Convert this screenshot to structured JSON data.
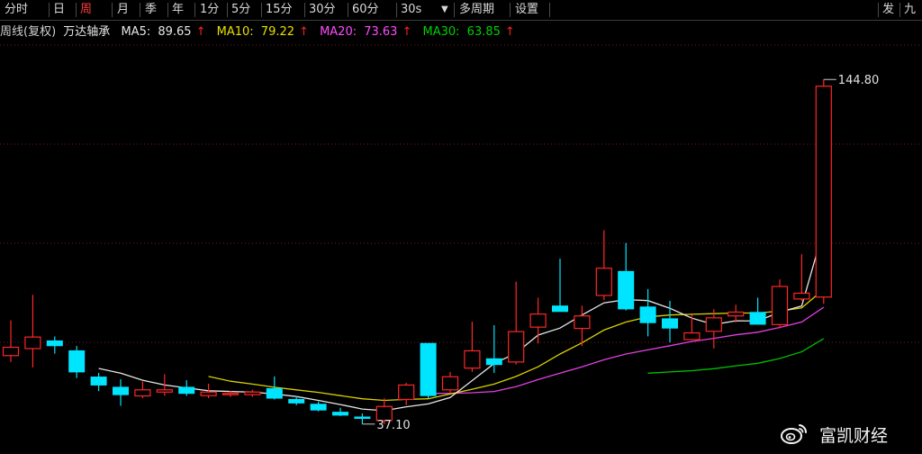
{
  "toolbar": {
    "items": [
      {
        "label": "分时",
        "active": false
      },
      {
        "label": "日",
        "active": false
      },
      {
        "label": "周",
        "active": true
      },
      {
        "label": "月",
        "active": false
      },
      {
        "label": "季",
        "active": false
      },
      {
        "label": "年",
        "active": false
      },
      {
        "label": "1分",
        "active": false
      },
      {
        "label": "5分",
        "active": false
      },
      {
        "label": "15分",
        "active": false
      },
      {
        "label": "30分",
        "active": false
      },
      {
        "label": "60分",
        "active": false
      },
      {
        "label": "30s",
        "active": false,
        "dropdown": true
      },
      {
        "label": "多周期",
        "active": false
      },
      {
        "label": "设置",
        "active": false
      }
    ],
    "right_items": [
      "发",
      "九"
    ]
  },
  "info": {
    "period_label": "周线(复权)",
    "stock_name": "万达轴承",
    "ma5": {
      "label": "MA5:",
      "value": "89.65",
      "arrow": "↑"
    },
    "ma10": {
      "label": "MA10:",
      "value": "79.22",
      "arrow": "↑"
    },
    "ma20": {
      "label": "MA20:",
      "value": "73.63",
      "arrow": "↑"
    },
    "ma30": {
      "label": "MA30:",
      "value": "63.85",
      "arrow": "↑"
    }
  },
  "colors": {
    "up": "#ff2626",
    "down": "#00e5ff",
    "ma5": "#e6e6e6",
    "ma10": "#d8d000",
    "ma20": "#e040e0",
    "ma30": "#00c000",
    "grid": "#7a1a1a"
  },
  "chart_data": {
    "type": "candlestick",
    "ylim": [
      30,
      155
    ],
    "high_label": "144.80",
    "low_label": "37.10",
    "candles": [
      {
        "o": 58.5,
        "h": 69.5,
        "l": 56.5,
        "c": 61.1
      },
      {
        "o": 60.7,
        "h": 77.5,
        "l": 54.8,
        "c": 64.3
      },
      {
        "o": 63.1,
        "h": 64.5,
        "l": 59.1,
        "c": 61.6
      },
      {
        "o": 60.0,
        "h": 61.5,
        "l": 51.5,
        "c": 53.4
      },
      {
        "o": 51.8,
        "h": 53.1,
        "l": 47.4,
        "c": 49.3
      },
      {
        "o": 48.6,
        "h": 51.1,
        "l": 42.8,
        "c": 46.3
      },
      {
        "o": 45.9,
        "h": 50.4,
        "l": 45.2,
        "c": 47.8
      },
      {
        "o": 47.1,
        "h": 52.7,
        "l": 45.9,
        "c": 47.8
      },
      {
        "o": 48.6,
        "h": 50.8,
        "l": 45.9,
        "c": 46.7
      },
      {
        "o": 46.0,
        "h": 49.7,
        "l": 45.2,
        "c": 47.1
      },
      {
        "o": 46.3,
        "h": 47.5,
        "l": 45.6,
        "c": 46.7
      },
      {
        "o": 46.3,
        "h": 47.8,
        "l": 45.6,
        "c": 47.1
      },
      {
        "o": 48.2,
        "h": 52.0,
        "l": 44.8,
        "c": 45.2
      },
      {
        "o": 44.8,
        "h": 45.9,
        "l": 43.0,
        "c": 43.7
      },
      {
        "o": 43.3,
        "h": 44.1,
        "l": 41.1,
        "c": 41.5
      },
      {
        "o": 40.8,
        "h": 42.2,
        "l": 39.6,
        "c": 39.9
      },
      {
        "o": 39.3,
        "h": 40.4,
        "l": 37.1,
        "c": 38.9
      },
      {
        "o": 38.2,
        "h": 45.2,
        "l": 37.1,
        "c": 42.6
      },
      {
        "o": 44.8,
        "h": 50.0,
        "l": 43.0,
        "c": 49.3
      },
      {
        "o": 62.3,
        "h": 62.3,
        "l": 45.2,
        "c": 46.0
      },
      {
        "o": 47.8,
        "h": 53.4,
        "l": 46.7,
        "c": 51.9
      },
      {
        "o": 54.6,
        "h": 69.1,
        "l": 53.4,
        "c": 60.0
      },
      {
        "o": 57.5,
        "h": 68.0,
        "l": 53.1,
        "c": 55.7
      },
      {
        "o": 56.5,
        "h": 81.6,
        "l": 55.7,
        "c": 66.0
      },
      {
        "o": 67.4,
        "h": 76.6,
        "l": 62.3,
        "c": 71.5
      },
      {
        "o": 74.0,
        "h": 88.8,
        "l": 72.6,
        "c": 72.3
      },
      {
        "o": 67.0,
        "h": 74.1,
        "l": 61.5,
        "c": 70.9
      },
      {
        "o": 77.3,
        "h": 97.7,
        "l": 75.8,
        "c": 85.8
      },
      {
        "o": 84.8,
        "h": 93.7,
        "l": 72.6,
        "c": 73.1
      },
      {
        "o": 73.7,
        "h": 79.3,
        "l": 64.5,
        "c": 68.8
      },
      {
        "o": 70.0,
        "h": 75.6,
        "l": 62.6,
        "c": 67.1
      },
      {
        "o": 63.5,
        "h": 71.2,
        "l": 63.5,
        "c": 65.6
      },
      {
        "o": 66.1,
        "h": 73.0,
        "l": 60.7,
        "c": 70.3
      },
      {
        "o": 70.9,
        "h": 74.4,
        "l": 68.8,
        "c": 72.1
      },
      {
        "o": 72.0,
        "h": 76.6,
        "l": 68.6,
        "c": 68.3
      },
      {
        "o": 68.2,
        "h": 82.3,
        "l": 67.0,
        "c": 80.1
      },
      {
        "o": 76.2,
        "h": 90.2,
        "l": 75.6,
        "c": 78.0
      },
      {
        "o": 76.8,
        "h": 144.8,
        "l": 74.7,
        "c": 142.7
      }
    ],
    "ma5": [
      {
        "i": 4,
        "v": 54.5
      },
      {
        "i": 5,
        "v": 53.0
      },
      {
        "i": 6,
        "v": 50.8
      },
      {
        "i": 7,
        "v": 49.3
      },
      {
        "i": 8,
        "v": 48.4
      },
      {
        "i": 9,
        "v": 47.5
      },
      {
        "i": 10,
        "v": 47.3
      },
      {
        "i": 11,
        "v": 47.1
      },
      {
        "i": 12,
        "v": 46.5
      },
      {
        "i": 13,
        "v": 45.7
      },
      {
        "i": 14,
        "v": 44.5
      },
      {
        "i": 15,
        "v": 43.2
      },
      {
        "i": 16,
        "v": 41.8
      },
      {
        "i": 17,
        "v": 41.3
      },
      {
        "i": 18,
        "v": 42.5
      },
      {
        "i": 19,
        "v": 43.4
      },
      {
        "i": 20,
        "v": 45.4
      },
      {
        "i": 21,
        "v": 50.7
      },
      {
        "i": 22,
        "v": 56.0
      },
      {
        "i": 23,
        "v": 59.3
      },
      {
        "i": 24,
        "v": 64.9
      },
      {
        "i": 25,
        "v": 67.1
      },
      {
        "i": 26,
        "v": 71.2
      },
      {
        "i": 27,
        "v": 75.0
      },
      {
        "i": 28,
        "v": 76.0
      },
      {
        "i": 29,
        "v": 75.7
      },
      {
        "i": 30,
        "v": 73.3
      },
      {
        "i": 31,
        "v": 70.2
      },
      {
        "i": 32,
        "v": 68.2
      },
      {
        "i": 33,
        "v": 69.4
      },
      {
        "i": 34,
        "v": 69.3
      },
      {
        "i": 35,
        "v": 72.1
      },
      {
        "i": 36,
        "v": 74.0
      },
      {
        "i": 37,
        "v": 98.0
      }
    ],
    "ma10": [
      {
        "i": 9,
        "v": 52.0
      },
      {
        "i": 10,
        "v": 50.5
      },
      {
        "i": 11,
        "v": 49.6
      },
      {
        "i": 12,
        "v": 48.6
      },
      {
        "i": 13,
        "v": 47.8
      },
      {
        "i": 14,
        "v": 47.0
      },
      {
        "i": 15,
        "v": 46.0
      },
      {
        "i": 16,
        "v": 45.0
      },
      {
        "i": 17,
        "v": 44.5
      },
      {
        "i": 18,
        "v": 44.8
      },
      {
        "i": 19,
        "v": 45.0
      },
      {
        "i": 20,
        "v": 46.5
      },
      {
        "i": 21,
        "v": 48.0
      },
      {
        "i": 22,
        "v": 49.6
      },
      {
        "i": 23,
        "v": 52.0
      },
      {
        "i": 24,
        "v": 55.0
      },
      {
        "i": 25,
        "v": 59.0
      },
      {
        "i": 26,
        "v": 62.5
      },
      {
        "i": 27,
        "v": 66.5
      },
      {
        "i": 28,
        "v": 69.0
      },
      {
        "i": 29,
        "v": 70.6
      },
      {
        "i": 30,
        "v": 71.2
      },
      {
        "i": 31,
        "v": 71.4
      },
      {
        "i": 32,
        "v": 71.6
      },
      {
        "i": 33,
        "v": 71.8
      },
      {
        "i": 34,
        "v": 71.8
      },
      {
        "i": 35,
        "v": 72.4
      },
      {
        "i": 36,
        "v": 73.4
      },
      {
        "i": 37,
        "v": 79.2
      }
    ],
    "ma20": [
      {
        "i": 19,
        "v": 46.7
      },
      {
        "i": 20,
        "v": 46.7
      },
      {
        "i": 21,
        "v": 46.9
      },
      {
        "i": 22,
        "v": 47.3
      },
      {
        "i": 23,
        "v": 48.8
      },
      {
        "i": 24,
        "v": 51.0
      },
      {
        "i": 25,
        "v": 53.0
      },
      {
        "i": 26,
        "v": 55.0
      },
      {
        "i": 27,
        "v": 57.2
      },
      {
        "i": 28,
        "v": 59.0
      },
      {
        "i": 29,
        "v": 60.3
      },
      {
        "i": 30,
        "v": 61.6
      },
      {
        "i": 31,
        "v": 62.9
      },
      {
        "i": 32,
        "v": 63.9
      },
      {
        "i": 33,
        "v": 65.0
      },
      {
        "i": 34,
        "v": 65.8
      },
      {
        "i": 35,
        "v": 67.3
      },
      {
        "i": 36,
        "v": 69.0
      },
      {
        "i": 37,
        "v": 73.6
      }
    ],
    "ma30": [
      {
        "i": 29,
        "v": 53.0
      },
      {
        "i": 30,
        "v": 53.4
      },
      {
        "i": 31,
        "v": 53.8
      },
      {
        "i": 32,
        "v": 54.4
      },
      {
        "i": 33,
        "v": 55.3
      },
      {
        "i": 34,
        "v": 56.1
      },
      {
        "i": 35,
        "v": 57.6
      },
      {
        "i": 36,
        "v": 59.7
      },
      {
        "i": 37,
        "v": 63.8
      }
    ]
  },
  "watermark": {
    "text": "富凯财经",
    "icon": "weibo-icon"
  }
}
